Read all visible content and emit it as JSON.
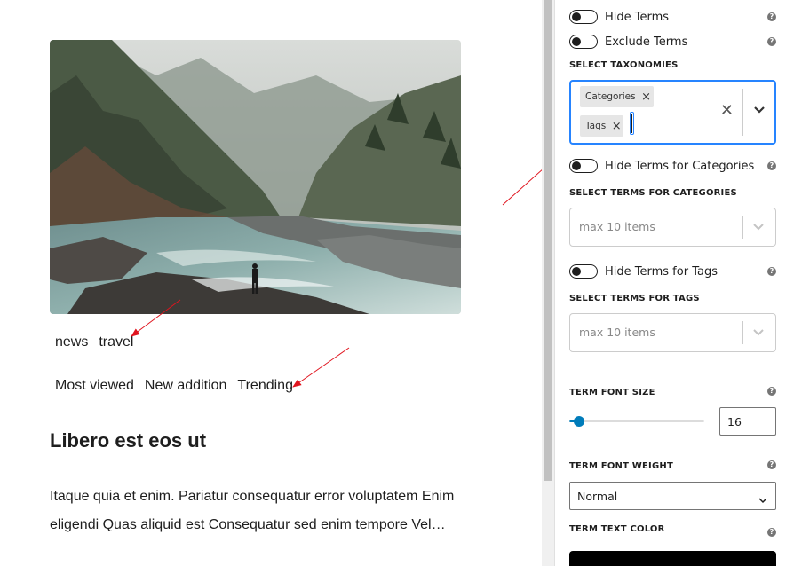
{
  "preview": {
    "term_rows": [
      [
        "news",
        "travel"
      ],
      [
        "Most viewed",
        "New addition",
        "Trending"
      ]
    ],
    "post_title": "Libero est eos ut",
    "excerpt_lines": [
      "Itaque quia et enim. Pariatur consequatur error voluptatem Enim",
      "eligendi Quas aliquid est Consequatur sed enim tempore Vel…"
    ]
  },
  "inspector": {
    "hide_terms": {
      "label": "Hide Terms",
      "on": false
    },
    "exclude_terms": {
      "label": "Exclude Terms",
      "on": false
    },
    "select_taxonomies": {
      "label": "SELECT TAXONOMIES",
      "selected": [
        "Categories",
        "Tags"
      ]
    },
    "hide_terms_categories": {
      "label": "Hide Terms for Categories",
      "on": false
    },
    "terms_categories": {
      "label": "SELECT TERMS FOR CATEGORIES",
      "placeholder": "max 10 items"
    },
    "hide_terms_tags": {
      "label": "Hide Terms for Tags",
      "on": false
    },
    "terms_tags": {
      "label": "SELECT TERMS FOR TAGS",
      "placeholder": "max 10 items"
    },
    "font_size": {
      "label": "TERM FONT SIZE",
      "value": "16",
      "slider_fraction": 0.07
    },
    "font_weight": {
      "label": "TERM FONT WEIGHT",
      "value": "Normal"
    },
    "text_color": {
      "label": "TERM TEXT COLOR",
      "value": "#000000"
    },
    "help_glyph": "?",
    "remove_glyph": "×",
    "clear_glyph": "✕"
  },
  "colors": {
    "accent": "#007cba",
    "focus": "#2684ff",
    "annotation_arrow": "#e0141e"
  }
}
